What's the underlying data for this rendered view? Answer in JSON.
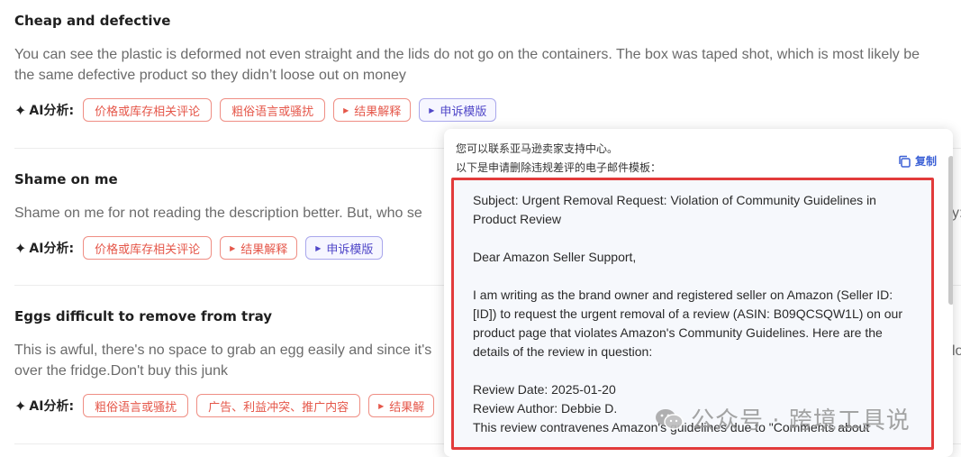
{
  "reviews": [
    {
      "title": "Cheap and defective",
      "body_lines": [
        "You can see the plastic is deformed not even straight and the lids do not go on the containers. The box was taped shot, which is most likely be",
        "the same defective product so they didn’t loose out on money"
      ],
      "tags": [
        "价格或库存相关评论",
        "粗俗语言或骚扰",
        "结果解释",
        "申诉模版"
      ]
    },
    {
      "title": "Shame on me",
      "body_lines": [
        "Shame on me for not reading the description better. But, who se",
        "y:"
      ],
      "tags": [
        "价格或库存相关评论",
        "结果解释",
        "申诉模版"
      ]
    },
    {
      "title": "Eggs difficult to remove from tray",
      "body_lines": [
        "This is awful, there's no space to grab an egg easily and since it's",
        "over the fridge.Don't buy this junk"
      ],
      "tags": [
        "粗俗语言或骚扰",
        "广告、利益冲突、推广内容",
        "结果解"
      ],
      "edge_char": "lo"
    }
  ],
  "ai_label": "AI分析:",
  "popup": {
    "intro_line1": "您可以联系亚马逊卖家支持中心。",
    "intro_line2": "以下是申请删除违规差评的电子邮件模板：",
    "copy_label": "复制",
    "email_paragraphs": [
      [
        "Subject: Urgent Removal Request: Violation of Community Guidelines in",
        "Product Review"
      ],
      [
        "Dear Amazon Seller Support,"
      ],
      [
        "I am writing as the brand owner and registered seller on Amazon (Seller ID:",
        "[ID]) to request the urgent removal of a review (ASIN: B09QCSQW1L) on our",
        "product page that violates Amazon's Community Guidelines. Here are the",
        "details of the review in question:"
      ],
      [
        "Review Date: 2025-01-20",
        "Review Author: Debbie D.",
        "This review contravenes Amazon's guidelines due to \"Comments about"
      ]
    ]
  },
  "watermark": "公众号 · 跨境工具说",
  "colors": {
    "tag_red": "#e5574a",
    "tag_blue": "#5047c8",
    "copy_blue": "#3c61d6",
    "highlight_red": "#e23b3b"
  }
}
